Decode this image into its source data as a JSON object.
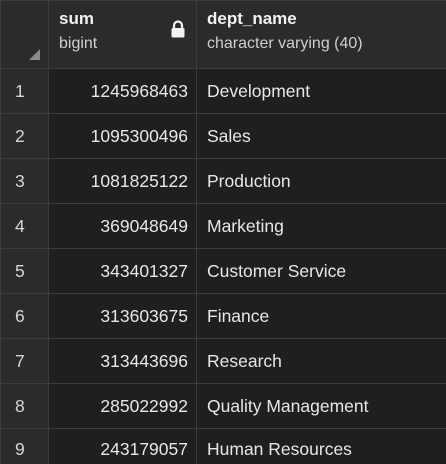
{
  "columns": [
    {
      "name": "sum",
      "type": "bigint",
      "locked": true
    },
    {
      "name": "dept_name",
      "type": "character varying (40)",
      "locked": false
    }
  ],
  "rows": [
    {
      "index": "1",
      "sum": "1245968463",
      "dept_name": "Development"
    },
    {
      "index": "2",
      "sum": "1095300496",
      "dept_name": "Sales"
    },
    {
      "index": "3",
      "sum": "1081825122",
      "dept_name": "Production"
    },
    {
      "index": "4",
      "sum": "369048649",
      "dept_name": "Marketing"
    },
    {
      "index": "5",
      "sum": "343401327",
      "dept_name": "Customer Service"
    },
    {
      "index": "6",
      "sum": "313603675",
      "dept_name": "Finance"
    },
    {
      "index": "7",
      "sum": "313443696",
      "dept_name": "Research"
    },
    {
      "index": "8",
      "sum": "285022992",
      "dept_name": "Quality Management"
    },
    {
      "index": "9",
      "sum": "243179057",
      "dept_name": "Human Resources"
    }
  ],
  "icons": {
    "lock": "lock-icon",
    "corner": "select-all-triangle-icon"
  },
  "colors": {
    "background": "#202020",
    "header_background": "#2b2b2b",
    "border": "#3c3c3c",
    "text": "#e7e7e7"
  }
}
